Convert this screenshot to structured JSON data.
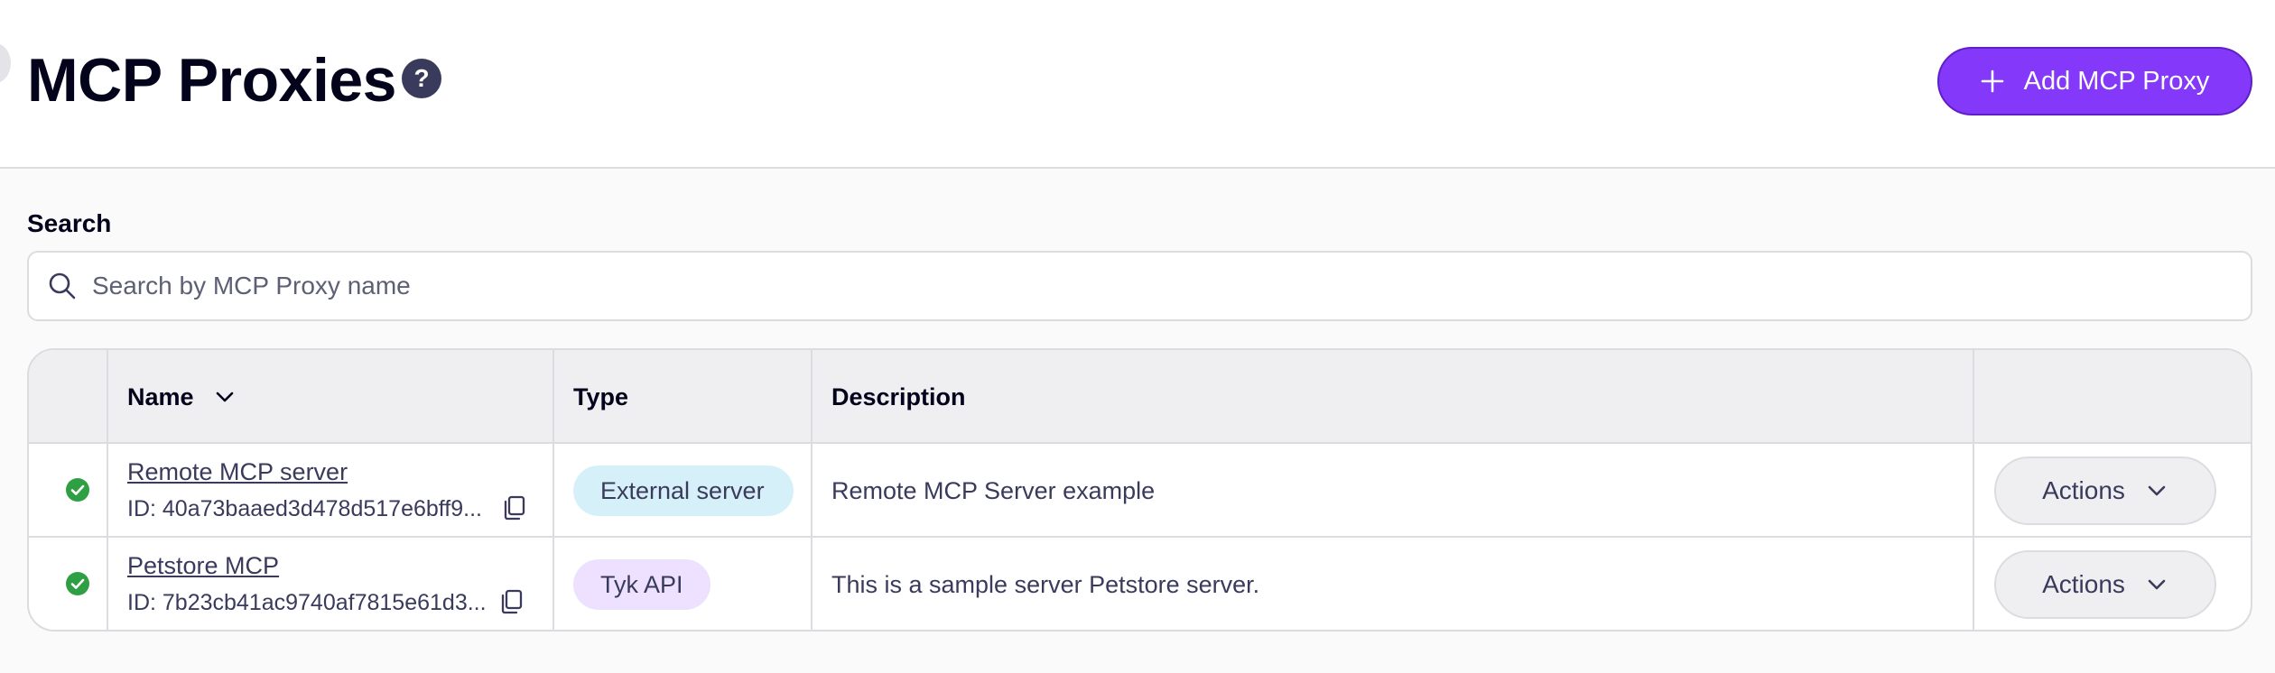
{
  "header": {
    "title": "MCP Proxies",
    "help_glyph": "?",
    "add_button_label": "Add MCP Proxy",
    "accent_color": "#8438fa"
  },
  "search": {
    "label": "Search",
    "placeholder": "Search by MCP Proxy name",
    "value": ""
  },
  "table": {
    "columns": [
      "",
      "Name",
      "Type",
      "Description",
      ""
    ],
    "sort_column": "Name",
    "rows": [
      {
        "status": "active",
        "status_color": "#2ea043",
        "name": "Remote MCP server",
        "id": "ID: 40a73baaed3d478d517e6bff9...",
        "type": "External server",
        "type_color": "#d6f0fa",
        "description": "Remote MCP Server example",
        "actions_label": "Actions"
      },
      {
        "status": "active",
        "status_color": "#2ea043",
        "name": "Petstore MCP",
        "id": "ID: 7b23cb41ac9740af7815e61d3...",
        "type": "Tyk API",
        "type_color": "#ede1ff",
        "description": "This is a sample server Petstore server.",
        "actions_label": "Actions"
      }
    ]
  },
  "icons": {
    "help": "question-circle-icon",
    "add": "plus-icon",
    "search": "search-icon",
    "sort": "chevron-down-icon",
    "status": "check-circle-icon",
    "copy": "copy-icon",
    "actions": "chevron-down-icon"
  }
}
